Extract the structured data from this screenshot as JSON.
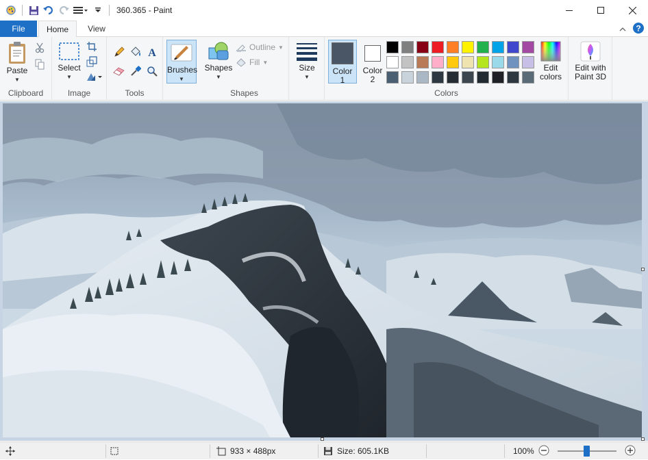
{
  "window": {
    "title": "360.365 - Paint"
  },
  "tabs": {
    "file": "File",
    "home": "Home",
    "view": "View"
  },
  "ribbon": {
    "clipboard": {
      "paste": "Paste",
      "group": "Clipboard"
    },
    "image": {
      "select": "Select",
      "group": "Image"
    },
    "tools": {
      "group": "Tools"
    },
    "brushes": {
      "label": "Brushes"
    },
    "shapes": {
      "label": "Shapes",
      "outline": "Outline",
      "fill": "Fill",
      "group": "Shapes"
    },
    "size": {
      "label": "Size"
    },
    "colors": {
      "color1_line1": "Color",
      "color1_line2": "1",
      "color2_line1": "Color",
      "color2_line2": "2",
      "edit_line1": "Edit",
      "edit_line2": "colors",
      "group": "Colors",
      "color1_value": "#4a5566",
      "color2_value": "#ffffff",
      "palette": [
        "#000000",
        "#7f7f7f",
        "#880015",
        "#ed1c24",
        "#ff7f27",
        "#fff200",
        "#22b14c",
        "#00a2e8",
        "#3f48cc",
        "#a349a4",
        "#ffffff",
        "#c3c3c3",
        "#b97a57",
        "#ffaec9",
        "#ffc90e",
        "#efe4b0",
        "#b5e61d",
        "#99d9ea",
        "#7092be",
        "#c8bfe7",
        "#4a5f72",
        "#c8d3dc",
        "#a9b8c4",
        "#2e3842",
        "#252c33",
        "#3b464f",
        "#222a31",
        "#1e2226",
        "#2d3740",
        "#5a6b78"
      ]
    },
    "paint3d": {
      "line1": "Edit with",
      "line2": "Paint 3D"
    }
  },
  "status": {
    "dimensions": "933 × 488px",
    "size": "Size: 605.1KB",
    "zoom": "100%",
    "zoom_level": 0.5
  }
}
